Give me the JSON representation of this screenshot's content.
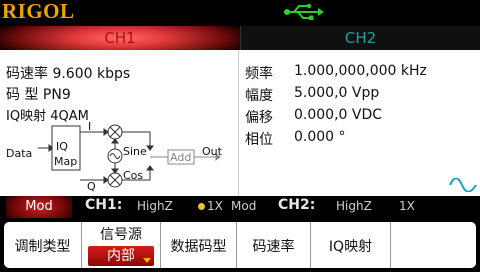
{
  "brand": {
    "logo": "RIGOL"
  },
  "tabs": [
    {
      "label": "CH1"
    },
    {
      "label": "CH2"
    }
  ],
  "left_panel": {
    "symbol_rate": "码速率 9.600 kbps",
    "code_type": "码  型 PN9",
    "iq_map": "IQ映射 4QAM"
  },
  "diagram": {
    "data": "Data",
    "iq": "IQ",
    "map": "Map",
    "i": "I",
    "q": "Q",
    "sine": "Sine",
    "cos": "Cos",
    "add": "Add",
    "out": "Out"
  },
  "right_panel": {
    "rows": [
      {
        "label": "频率",
        "value": "1.000,000,000 kHz"
      },
      {
        "label": "幅度",
        "value": "5.000,0 Vpp"
      },
      {
        "label": "偏移",
        "value": "0.000,0 VDC"
      },
      {
        "label": "相位",
        "value": "0.000 °"
      }
    ]
  },
  "status_bar": {
    "mode": "Mod",
    "ch1_label": "CH1:",
    "ch1_impedance": "HighZ",
    "ch1_gain": "1X",
    "ch1_mode": "Mod",
    "ch2_label": "CH2:",
    "ch2_impedance": "HighZ",
    "ch2_gain": "1X"
  },
  "menu": {
    "items": [
      {
        "label": "调制类型"
      },
      {
        "label": "信号源",
        "value": "内部"
      },
      {
        "label": "数据码型"
      },
      {
        "label": "码速率"
      },
      {
        "label": "IQ映射"
      }
    ]
  },
  "colors": {
    "ch1": "#e23a3a",
    "ch2": "#1aa3a3",
    "logo": "#f0a300",
    "usb": "#27d227"
  }
}
